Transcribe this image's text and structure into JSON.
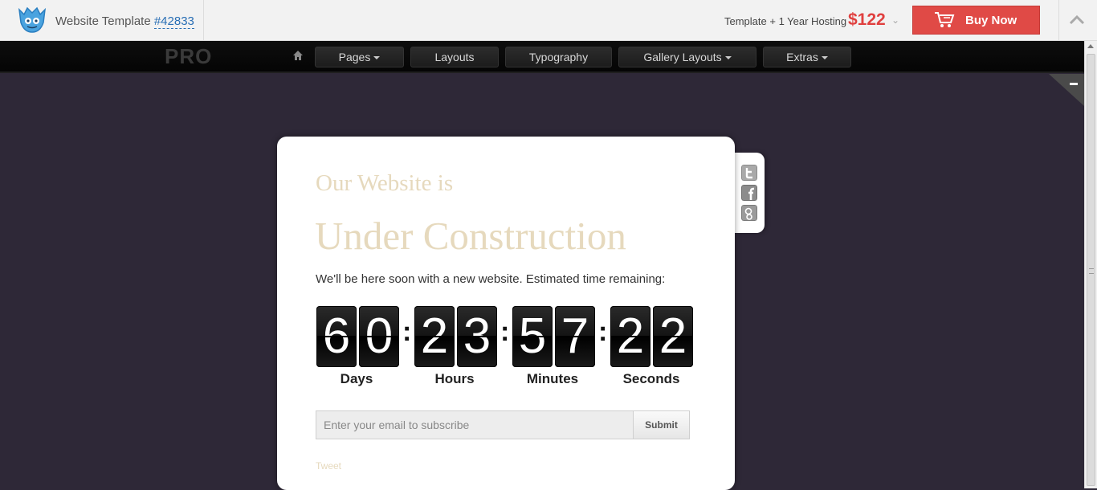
{
  "topbar": {
    "site_label": "Website Template ",
    "template_id": "#42833",
    "hosting_label": "Template + 1 Year Hosting",
    "price": "$122",
    "buy_label": "Buy Now",
    "accent_color": "#e04a46"
  },
  "nav": {
    "brand": "PRO",
    "items": [
      {
        "label": "Pages",
        "dropdown": true
      },
      {
        "label": "Layouts",
        "dropdown": false
      },
      {
        "label": "Typography",
        "dropdown": false
      },
      {
        "label": "Gallery Layouts",
        "dropdown": true
      },
      {
        "label": "Extras",
        "dropdown": true
      }
    ]
  },
  "main": {
    "title_small": "Our Website is",
    "title_large": "Under Construction",
    "description": "We'll be here soon with a new website. Estimated time remaining:",
    "countdown": {
      "days": [
        "6",
        "0"
      ],
      "hours": [
        "2",
        "3"
      ],
      "minutes": [
        "5",
        "7"
      ],
      "seconds": [
        "2",
        "2"
      ],
      "labels": {
        "days": "Days",
        "hours": "Hours",
        "minutes": "Minutes",
        "seconds": "Seconds"
      }
    },
    "subscribe": {
      "placeholder": "Enter your email to subscribe",
      "button": "Submit"
    },
    "tweet": "Tweet"
  },
  "social": [
    "twitter-icon",
    "facebook-icon",
    "google-plus-icon"
  ],
  "colors": {
    "background": "#2e2837",
    "headline": "#e6d9bd",
    "price": "#e0403f"
  }
}
